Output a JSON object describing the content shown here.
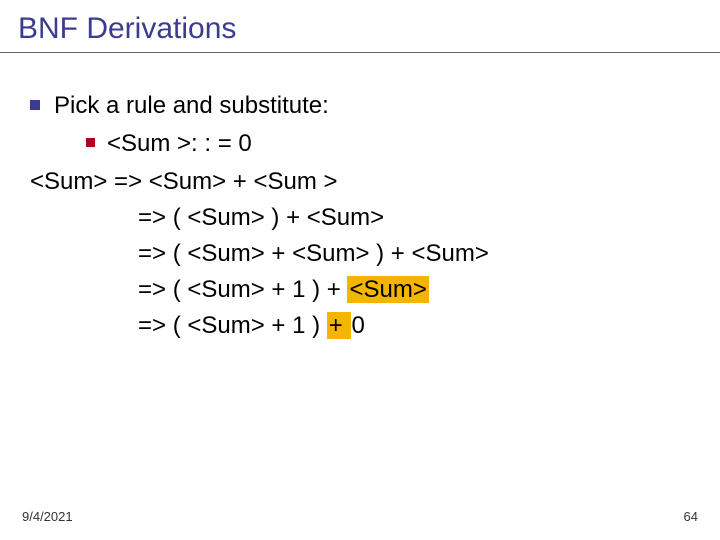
{
  "title": "BNF Derivations",
  "bullet1": "Pick a rule and substitute:",
  "bullet2": "<Sum >: : = 0",
  "deriv": {
    "l1": "<Sum> => <Sum> + <Sum >",
    "l2": "=> ( <Sum> ) + <Sum>",
    "l3": "=> ( <Sum> + <Sum> ) + <Sum>",
    "l4a": "=> ( <Sum> + 1 ) + ",
    "l4b": "<Sum>",
    "l5a": "=> ( <Sum> + 1 ) ",
    "l5b": "+ ",
    "l5c": "0"
  },
  "footer": {
    "date": "9/4/2021",
    "page": "64"
  }
}
